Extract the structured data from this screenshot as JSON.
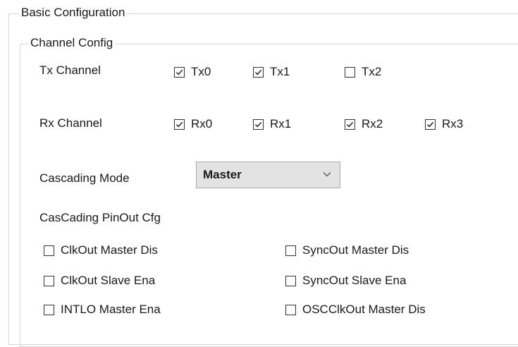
{
  "basic_config": {
    "title": "Basic Configuration"
  },
  "channel_config": {
    "title": "Channel Config",
    "tx": {
      "label": "Tx Channel",
      "items": [
        {
          "label": "Tx0",
          "checked": true
        },
        {
          "label": "Tx1",
          "checked": true
        },
        {
          "label": "Tx2",
          "checked": false
        }
      ]
    },
    "rx": {
      "label": "Rx Channel",
      "items": [
        {
          "label": "Rx0",
          "checked": true
        },
        {
          "label": "Rx1",
          "checked": true
        },
        {
          "label": "Rx2",
          "checked": true
        },
        {
          "label": "Rx3",
          "checked": true
        }
      ]
    },
    "cascading_mode": {
      "label": "Cascading Mode",
      "value": "Master"
    },
    "pinout": {
      "label": "CasCading PinOut Cfg",
      "items": [
        {
          "label": "ClkOut Master Dis",
          "checked": false
        },
        {
          "label": "SyncOut Master Dis",
          "checked": false
        },
        {
          "label": "ClkOut Slave Ena",
          "checked": false
        },
        {
          "label": "SyncOut Slave Ena",
          "checked": false
        },
        {
          "label": "INTLO Master Ena",
          "checked": false
        },
        {
          "label": "OSCClkOut Master Dis",
          "checked": false
        }
      ]
    }
  }
}
